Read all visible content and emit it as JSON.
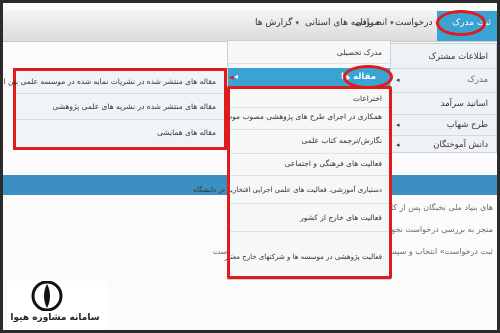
{
  "navbar": {
    "active": "ثبت مدرک",
    "items": [
      "گزارش ها",
      "برنامه های استانی",
      "انصرافی",
      "ثبت درخواست"
    ]
  },
  "menu1": {
    "items": [
      "اطلاعات مشترک",
      "مدرک",
      "اساتید سرآمد",
      "طرح شهاب",
      "دانش آموختگان"
    ]
  },
  "menu2": {
    "items": [
      "مدرک تحصیلی",
      "مقاله ها",
      "اختراعات",
      "همکاری در اجرای طرح های پژوهشی مصوب موسسه",
      "نگارش/ترجمه کتاب علمی",
      "فعالیت های فرهنگی و اجتماعی",
      "دستیاری آموزشی، فعالیت های علمی اجرایی افتخاریه در دانشگاه",
      "فعالیت های خارج از کشور",
      "فعالیت پژوهشی در موسسه ها و شرکتهای خارج معتبر"
    ]
  },
  "menu3": {
    "items": [
      "مقاله های منتشر شده در نشریات نمایه شده در موسسه علمی بین المللی معتبر",
      "مقاله های منتشر شده در نشریه های علمی پژوهشی",
      "مقاله های همایشی"
    ]
  },
  "body_text": [
    "های بنیاد ملی نخبگان پس از کلیک بر رو",
    "منجر به بررسی درخواست نخواهد شد و",
    "ثبت درخواست» انتخاب و سپس در انتهای صفحه مورد مشاهده، دکمه ثبت درخواست"
  ],
  "logo": {
    "text": "سامانه مشاوره هیوا"
  },
  "colors": {
    "accent": "#3aa3d4",
    "highlight": "#e01b1b",
    "band": "#3b8fc1"
  },
  "icons": [
    "caret-down-icon",
    "chevron-left-icon",
    "logo-emblem"
  ]
}
